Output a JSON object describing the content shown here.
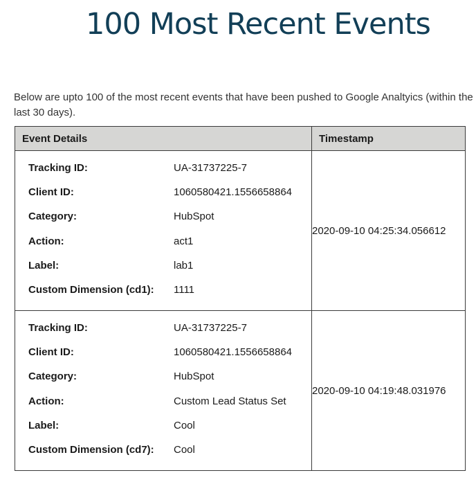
{
  "page": {
    "title": "100 Most Recent Events",
    "intro": "Below are upto 100 of the most recent events that have been pushed to Google Analtyics (within the\nlast 30 days)."
  },
  "table": {
    "headers": {
      "details": "Event Details",
      "timestamp": "Timestamp"
    },
    "events": [
      {
        "fields": [
          {
            "label": "Tracking ID:",
            "value": "UA-31737225-7"
          },
          {
            "label": "Client ID:",
            "value": "1060580421.1556658864"
          },
          {
            "label": "Category:",
            "value": "HubSpot"
          },
          {
            "label": "Action:",
            "value": "act1"
          },
          {
            "label": "Label:",
            "value": "lab1"
          },
          {
            "label": "Custom Dimension (cd1):",
            "value": "1111"
          }
        ],
        "timestamp": "2020-09-10 04:25:34.056612"
      },
      {
        "fields": [
          {
            "label": "Tracking ID:",
            "value": "UA-31737225-7"
          },
          {
            "label": "Client ID:",
            "value": "1060580421.1556658864"
          },
          {
            "label": "Category:",
            "value": "HubSpot"
          },
          {
            "label": "Action:",
            "value": "Custom Lead Status Set"
          },
          {
            "label": "Label:",
            "value": "Cool"
          },
          {
            "label": "Custom Dimension (cd7):",
            "value": "Cool"
          }
        ],
        "timestamp": "2020-09-10 04:19:48.031976"
      }
    ]
  }
}
